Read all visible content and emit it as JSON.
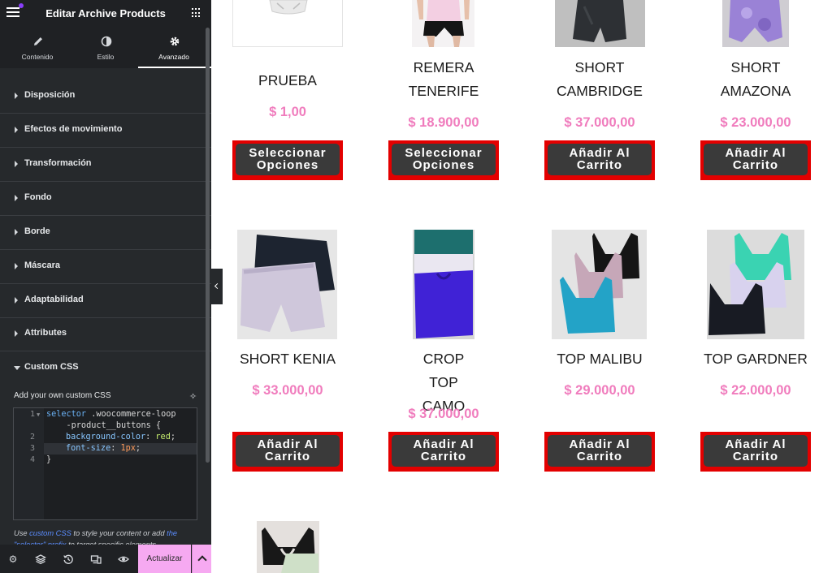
{
  "sidebar": {
    "title": "Editar Archive Products",
    "tabs": [
      {
        "label": "Contenido",
        "icon": "pencil-icon"
      },
      {
        "label": "Estilo",
        "icon": "half-circle-icon"
      },
      {
        "label": "Avanzado",
        "icon": "gear-icon",
        "active": true
      }
    ],
    "sections": [
      {
        "label": "Disposición"
      },
      {
        "label": "Efectos de movimiento"
      },
      {
        "label": "Transformación"
      },
      {
        "label": "Fondo"
      },
      {
        "label": "Borde"
      },
      {
        "label": "Máscara"
      },
      {
        "label": "Adaptabilidad"
      },
      {
        "label": "Attributes"
      },
      {
        "label": "Custom CSS",
        "expanded": true
      }
    ],
    "custom_css": {
      "label": "Add your own custom CSS",
      "line_numbers": [
        "1",
        "2",
        "3",
        "4"
      ],
      "code": {
        "l1_sel": "selector",
        "l1_rest": " .woocommerce-loop",
        "l1b": "    -product__buttons {",
        "l2_prop": "background-color",
        "l2_colon": ": ",
        "l2_val": "red",
        "l2_end": ";",
        "l3_prop": "font-size",
        "l3_colon": ": ",
        "l3_val": "1px",
        "l3_end": ";",
        "l4": "}"
      },
      "help": {
        "t1": "Use ",
        "link1": "custom CSS",
        "t2": " to style your content or add ",
        "link2": "the \"selector\" prefix",
        "t3": " to target specific elements."
      }
    },
    "footer": {
      "icons": [
        "gear-icon",
        "layers-icon",
        "history-icon",
        "responsive-icon",
        "eye-icon"
      ],
      "update_label": "Actualizar"
    }
  },
  "colors": {
    "accent": "#f6a9f1",
    "price": "#f07cbd",
    "button_border": "#e30000",
    "button_bg": "#3a3a3a"
  },
  "products": [
    {
      "name": "PRUEBA",
      "price": "$ 1,00",
      "button": "Seleccionar Opciones"
    },
    {
      "name": "REMERA TENERIFE",
      "price": "$ 18.900,00",
      "button": "Seleccionar Opciones"
    },
    {
      "name": "SHORT CAMBRIDGE",
      "price": "$ 37.000,00",
      "button": "Añadir Al Carrito"
    },
    {
      "name": "SHORT AMAZONA",
      "price": "$ 23.000,00",
      "button": "Añadir Al Carrito"
    },
    {
      "name": "SHORT KENIA",
      "price": "$ 33.000,00",
      "button": "Añadir Al Carrito"
    },
    {
      "name": "CROP TOP CAMO",
      "price": "$ 37.000,00",
      "button": "Añadir Al Carrito"
    },
    {
      "name": "TOP MALIBU",
      "price": "$ 29.000,00",
      "button": "Añadir Al Carrito"
    },
    {
      "name": "TOP GARDNER",
      "price": "$ 22.000,00",
      "button": "Añadir Al Carrito"
    }
  ]
}
